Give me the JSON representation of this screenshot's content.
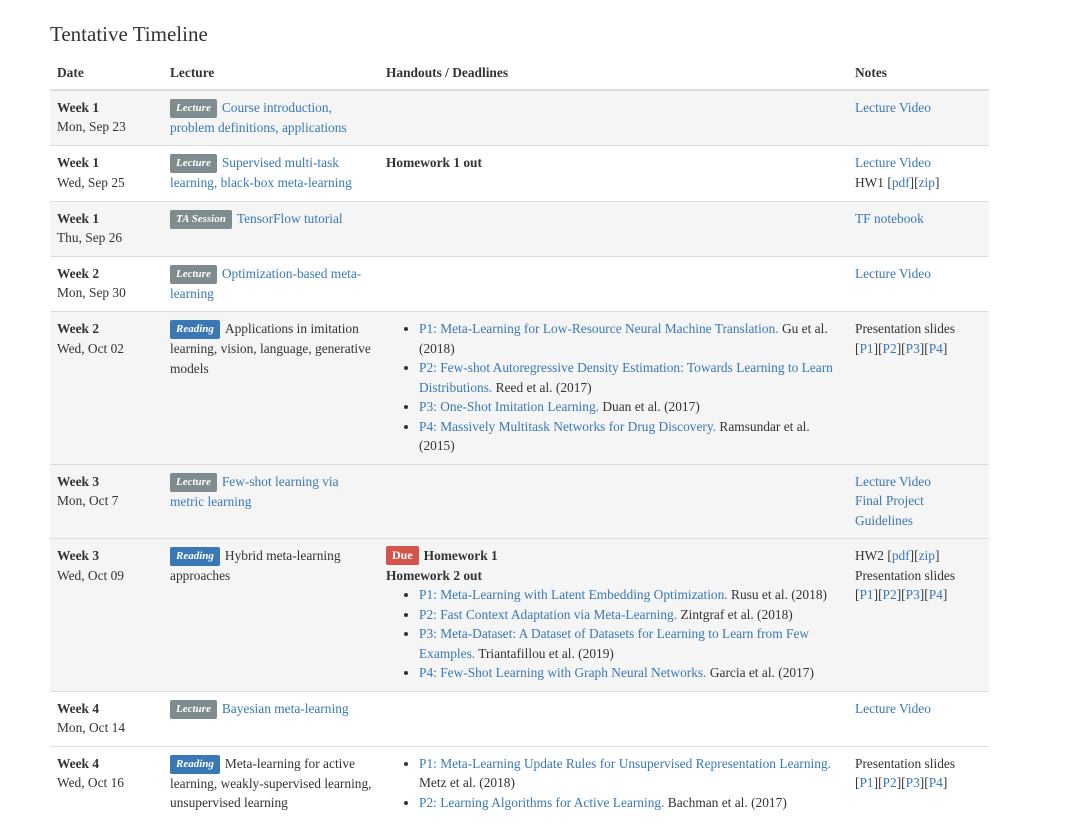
{
  "page_title": "Tentative Timeline",
  "columns": [
    "Date",
    "Lecture",
    "Handouts / Deadlines",
    "Notes"
  ],
  "colors": {
    "link": "#3a78b5",
    "badge_gray": "#7e8b8f",
    "badge_blue": "#3a78b5",
    "badge_red": "#d3544a",
    "row_alt": "#f5f5f5"
  },
  "rows": [
    {
      "week": "Week 1",
      "date": "Mon, Sep 23",
      "badge": "Lecture",
      "title": "Course introduction, problem definitions, applications",
      "notes": [
        {
          "text": "Lecture Video"
        }
      ]
    },
    {
      "week": "Week 1",
      "date": "Wed, Sep 25",
      "badge": "Lecture",
      "title": "Supervised multi-task learning, black-box meta-learning",
      "handout": "Homework 1 out",
      "notes_video": "Lecture Video",
      "notes_hw": {
        "prefix": "HW1 [",
        "pdf": "pdf",
        "mid": "][",
        "zip": "zip",
        "suffix": "]"
      }
    },
    {
      "week": "Week 1",
      "date": "Thu, Sep 26",
      "badge": "TA Session",
      "title": "TensorFlow tutorial",
      "notes": [
        {
          "text": "TF notebook"
        }
      ]
    },
    {
      "week": "Week 2",
      "date": "Mon, Sep 30",
      "badge": "Lecture",
      "title": "Optimization-based meta-learning",
      "notes": [
        {
          "text": "Lecture Video"
        }
      ]
    },
    {
      "week": "Week 2",
      "date": "Wed, Oct 02",
      "badge": "Reading",
      "title": "Applications in imitation learning, vision, language, generative models",
      "papers": [
        {
          "link": "P1: Meta-Learning for Low-Resource Neural Machine Translation.",
          "authors": " Gu et al. (2018)"
        },
        {
          "link": "P2: Few-shot Autoregressive Density Estimation: Towards Learning to Learn Distributions.",
          "authors": " Reed et al. (2017)"
        },
        {
          "link": "P3: One-Shot Imitation Learning.",
          "authors": " Duan et al. (2017)"
        },
        {
          "link": "P4: Massively Multitask Networks for Drug Discovery.",
          "authors": " Ramsundar et al. (2015)"
        }
      ],
      "slides_label": "Presentation slides",
      "slides": [
        "P1",
        "P2",
        "P3",
        "P4"
      ]
    },
    {
      "week": "Week 3",
      "date": "Mon, Oct 7",
      "badge": "Lecture",
      "title": "Few-shot learning via metric learning",
      "notes": [
        {
          "text": "Lecture Video"
        },
        {
          "text": "Final Project Guidelines"
        }
      ]
    },
    {
      "week": "Week 3",
      "date": "Wed, Oct 09",
      "badge": "Reading",
      "title": "Hybrid meta-learning approaches",
      "due_badge": "Due",
      "due_item": "Homework 1",
      "handout": "Homework 2 out",
      "papers": [
        {
          "link": "P1: Meta-Learning with Latent Embedding Optimization.",
          "authors": " Rusu et al. (2018)"
        },
        {
          "link": "P2: Fast Context Adaptation via Meta-Learning.",
          "authors": " Zintgraf et al. (2018)"
        },
        {
          "link": "P3: Meta-Dataset: A Dataset of Datasets for Learning to Learn from Few Examples.",
          "authors": " Triantafillou et al. (2019)"
        },
        {
          "link": "P4: Few-Shot Learning with Graph Neural Networks.",
          "authors": " Garcia et al. (2017)"
        }
      ],
      "notes_hw": {
        "prefix": "HW2 [",
        "pdf": "pdf",
        "mid": "][",
        "zip": "zip",
        "suffix": "]"
      },
      "slides_label": "Presentation slides",
      "slides": [
        "P1",
        "P2",
        "P3",
        "P4"
      ]
    },
    {
      "week": "Week 4",
      "date": "Mon, Oct 14",
      "badge": "Lecture",
      "title": "Bayesian meta-learning",
      "notes": [
        {
          "text": "Lecture Video"
        }
      ]
    },
    {
      "week": "Week 4",
      "date": "Wed, Oct 16",
      "badge": "Reading",
      "title": "Meta-learning for active learning, weakly-supervised learning, unsupervised learning",
      "papers": [
        {
          "link": "P1: Meta-Learning Update Rules for Unsupervised Representation Learning.",
          "authors": " Metz et al. (2018)"
        },
        {
          "link": "P2: Learning Algorithms for Active Learning.",
          "authors": " Bachman et al. (2017)"
        }
      ],
      "slides_label": "Presentation slides",
      "slides": [
        "P1",
        "P2",
        "P3",
        "P4"
      ]
    }
  ]
}
